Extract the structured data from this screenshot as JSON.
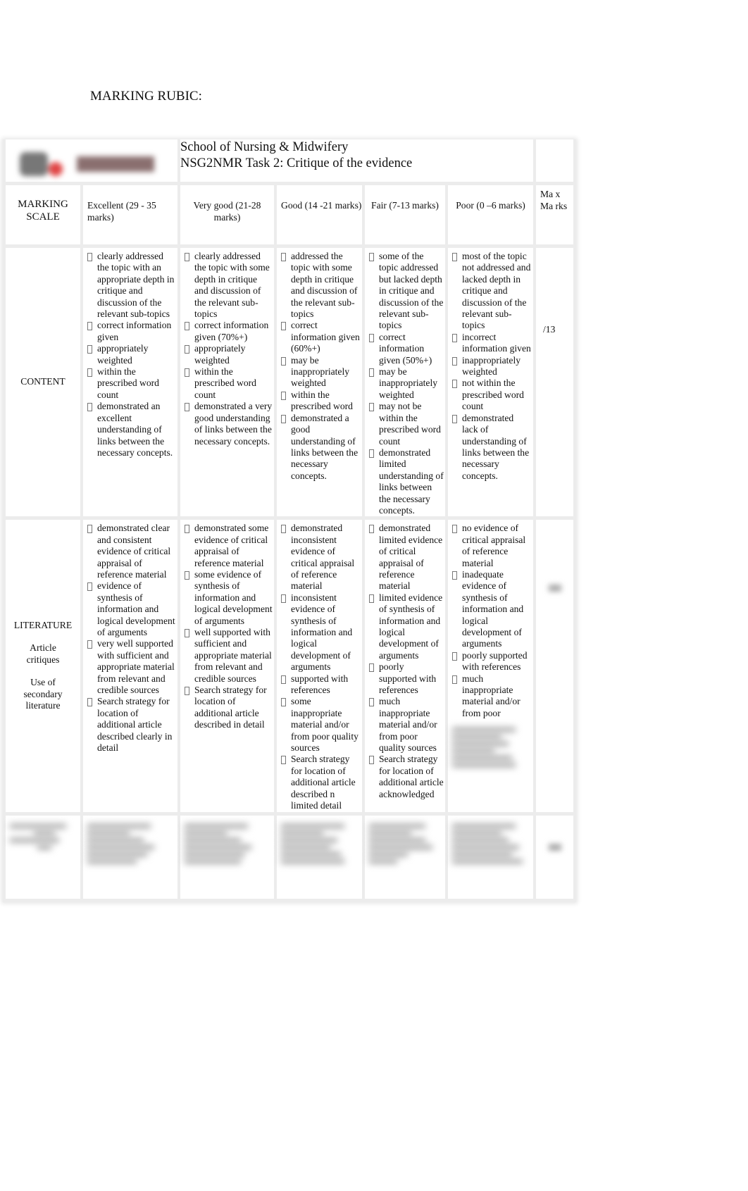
{
  "document": {
    "heading": "MARKING RUBIC:"
  },
  "rubric": {
    "school": "School of Nursing & Midwifery",
    "task": "NSG2NMR Task 2: Critique of the evidence",
    "scale_label": "MARKING SCALE",
    "bands": [
      "Excellent (29 - 35 marks)",
      "Very good (21-28 marks)",
      "Good (14 -21 marks)",
      "Fair (7-13 marks)",
      "Poor (0 –6 marks)"
    ],
    "max_marks_header": "Ma x Ma rks",
    "rows": [
      {
        "criterion": "CONTENT",
        "criterion_sub": [],
        "max": "/13",
        "cells": [
          [
            "clearly addressed the topic with an appropriate depth in critique and discussion of the relevant sub-topics",
            "correct information given",
            "appropriately weighted",
            "within the prescribed word count",
            "demonstrated an excellent understanding of links between the necessary concepts."
          ],
          [
            "clearly addressed the topic with some depth in critique and discussion of the relevant sub-topics",
            "correct information given (70%+)",
            "appropriately weighted",
            "within the prescribed word count",
            "demonstrated a very good understanding of links between the necessary concepts."
          ],
          [
            "addressed the topic with some depth in critique and discussion of the relevant sub-topics",
            "correct information given (60%+)",
            "may be inappropriately weighted",
            "within the prescribed word",
            "demonstrated a good understanding of links between the necessary concepts."
          ],
          [
            "some of the topic addressed but lacked depth in critique and discussion of the relevant sub-topics",
            "correct information given (50%+)",
            "may be inappropriately weighted",
            "may not be within the prescribed word count",
            "demonstrated limited understanding of links between the necessary concepts."
          ],
          [
            "most of the topic not addressed and lacked depth in critique and discussion of the relevant sub-topics",
            "incorrect information given",
            "inappropriately weighted",
            "not within the prescribed word count",
            "demonstrated lack of understanding of links between the necessary concepts."
          ]
        ]
      },
      {
        "criterion": "LITERATURE",
        "criterion_sub": [
          "Article critiques",
          "Use of secondary literature"
        ],
        "max": "",
        "cells": [
          [
            "demonstrated clear and consistent evidence of critical appraisal of reference material",
            "evidence of synthesis of information and logical development of arguments",
            "very well supported with sufficient and appropriate material from relevant and credible sources",
            "Search strategy for location of additional article described clearly in detail"
          ],
          [
            "demonstrated some evidence of critical appraisal of reference material",
            "some evidence of synthesis of information and logical development of arguments",
            "well supported with sufficient and appropriate material from relevant and credible sources",
            "Search strategy for location of additional article described in detail"
          ],
          [
            "demonstrated inconsistent evidence of critical appraisal of reference material",
            "inconsistent evidence of synthesis of information and logical development of arguments",
            "supported with references",
            "some inappropriate material and/or from poor quality sources",
            "Search strategy for location of additional article described n limited detail"
          ],
          [
            "demonstrated limited evidence of critical appraisal of reference material",
            "limited evidence of synthesis of information and logical development of arguments",
            "poorly supported with references",
            "much inappropriate material and/or from poor quality sources",
            "Search strategy for location of additional article acknowledged"
          ],
          [
            "no evidence of critical appraisal of reference material",
            "inadequate evidence of synthesis of information and logical development of arguments",
            "poorly supported with references",
            "much inappropriate material and/or from poor"
          ]
        ]
      }
    ]
  }
}
